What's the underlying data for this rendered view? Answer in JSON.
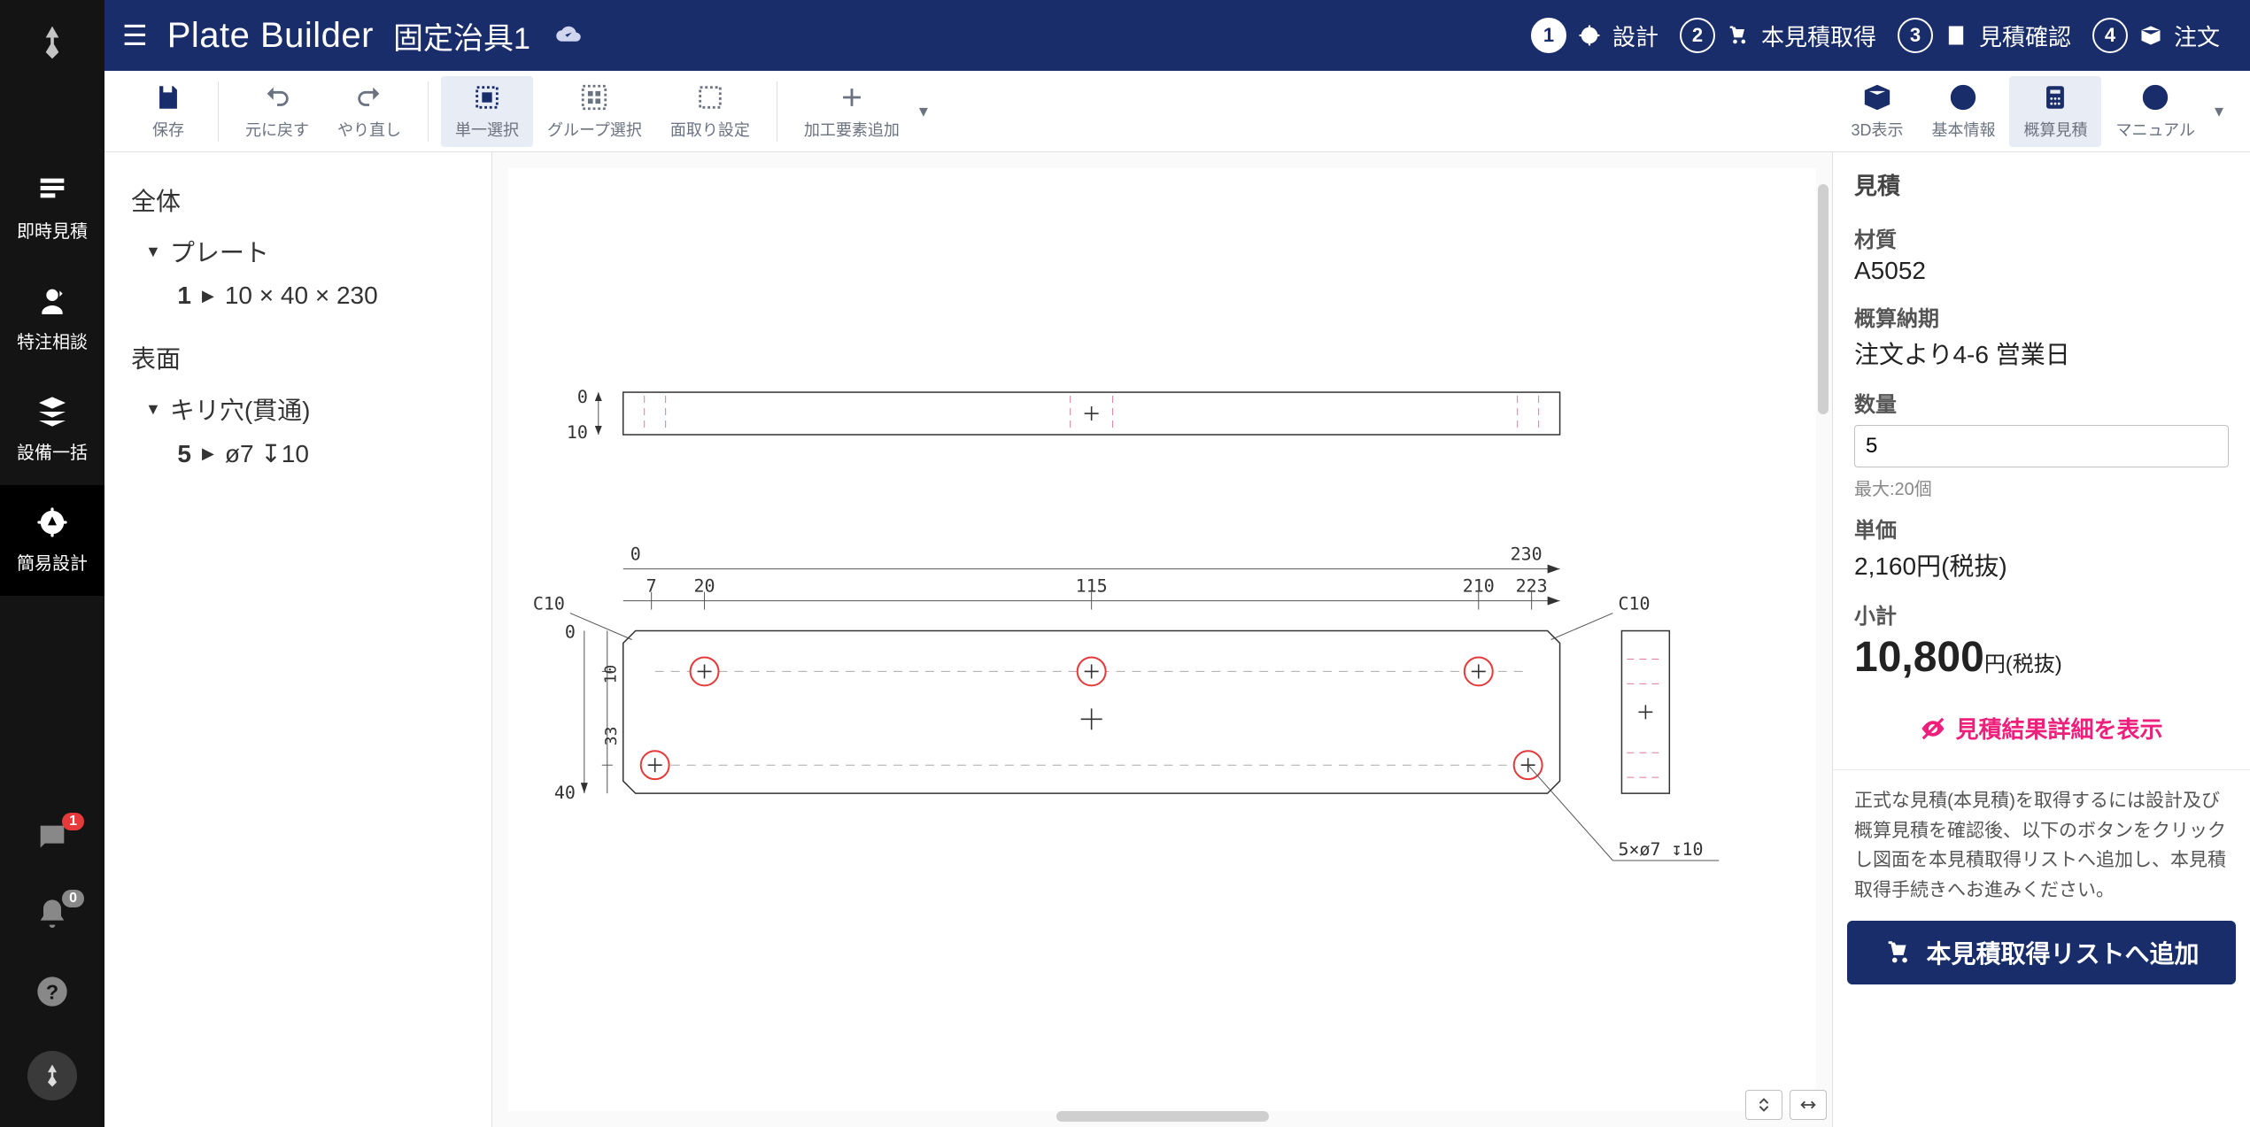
{
  "header": {
    "app_title": "Plate Builder",
    "project_name": "固定治具1"
  },
  "steps": [
    {
      "num": "1",
      "label": "設計",
      "active": true
    },
    {
      "num": "2",
      "label": "本見積取得",
      "active": false
    },
    {
      "num": "3",
      "label": "見積確認",
      "active": false
    },
    {
      "num": "4",
      "label": "注文",
      "active": false
    }
  ],
  "toolbar_left": {
    "save": "保存",
    "undo": "元に戻す",
    "redo": "やり直し",
    "single_select": "単一選択",
    "group_select": "グループ選択",
    "chamfer": "面取り設定",
    "add_feature": "加工要素追加"
  },
  "toolbar_right": {
    "view3d": "3D表示",
    "basic_info": "基本情報",
    "estimate": "概算見積",
    "manual": "マニュアル"
  },
  "rail": {
    "instant_estimate": "即時見積",
    "custom_consult": "特注相談",
    "equipment": "設備一括",
    "simple_design": "簡易設計",
    "chat_badge": "1",
    "bell_badge": "0"
  },
  "tree": {
    "all": "全体",
    "plate": "プレート",
    "plate_items": [
      {
        "idx": "1",
        "label": "10 × 40 × 230"
      }
    ],
    "surface": "表面",
    "hole_group": "キリ穴(貫通)",
    "hole_items": [
      {
        "idx": "5",
        "label": "ø7 ↧10"
      }
    ]
  },
  "drawing": {
    "top_dim_zero": "0",
    "top_height": "10",
    "main_zero": "0",
    "main_total": "230",
    "x_7": "7",
    "x_20": "20",
    "x_115": "115",
    "x_210": "210",
    "x_223": "223",
    "c10_l": "C10",
    "c10_r": "C10",
    "y_10": "10",
    "y_33": "33",
    "y_40": "40",
    "callout": "5×ø7 ↧10"
  },
  "estimate": {
    "title": "見積",
    "material_label": "材質",
    "material_value": "A5052",
    "lead_label": "概算納期",
    "lead_value": "注文より4-6 営業日",
    "qty_label": "数量",
    "qty_value": "5",
    "qty_note": "最大:20個",
    "unit_price_label": "単価",
    "unit_price_value": "2,160円(税抜)",
    "subtotal_label": "小計",
    "subtotal_value": "10,800",
    "subtotal_unit": "円(税抜)",
    "detail_link": "見積結果詳細を表示",
    "note": "正式な見積(本見積)を取得するには設計及び概算見積を確認後、以下のボタンをクリックし図面を本見積取得リストへ追加し、本見積取得手続きへお進みください。",
    "cta": "本見積取得リストへ追加"
  }
}
